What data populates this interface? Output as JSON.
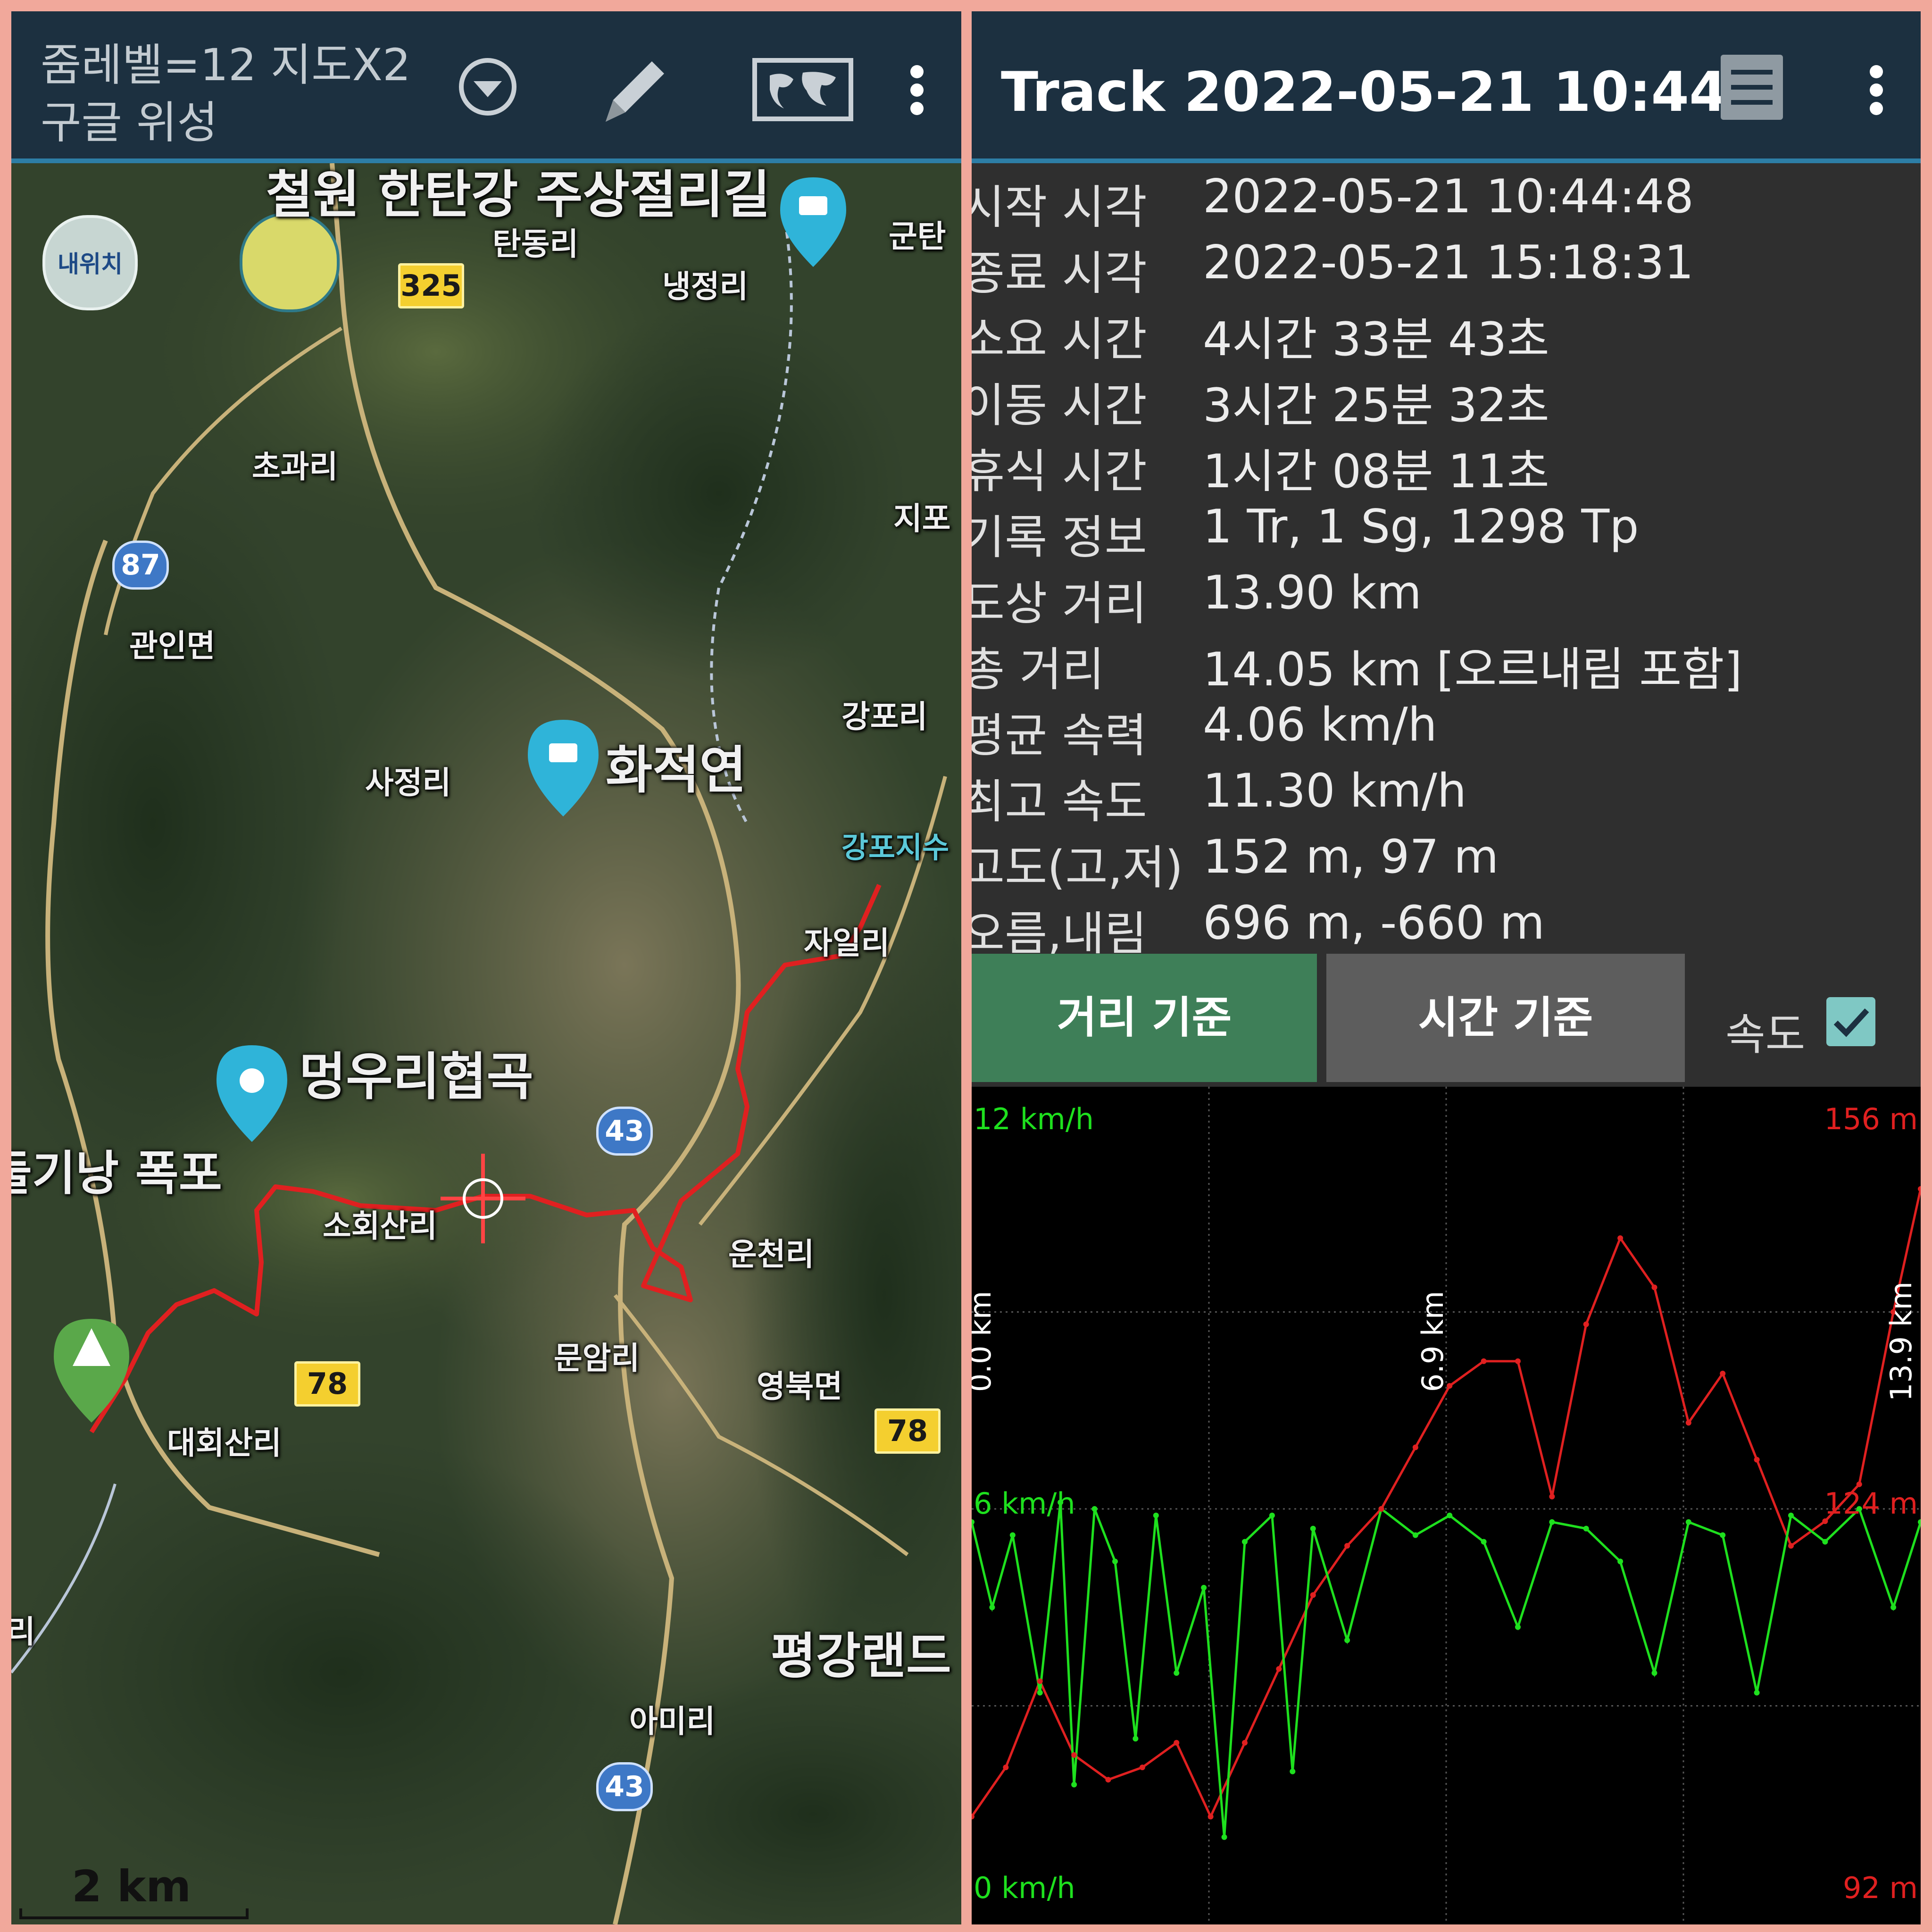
{
  "map_screen": {
    "zoom_line": "줌레벨=12 지도X2",
    "map_source": "구글 위성",
    "icons": [
      "dropdown-icon",
      "pencil-icon",
      "world-map-icon",
      "more-vert-icon"
    ],
    "my_location_button": "내위치",
    "place_labels": [
      {
        "id": "cheorwon",
        "text": "철원 한탄강 주상절리길"
      },
      {
        "id": "tandong",
        "text": "탄동리"
      },
      {
        "id": "nangjeong",
        "text": "냉정리"
      },
      {
        "id": "guntan",
        "text": "군탄"
      },
      {
        "id": "chogwa",
        "text": "초과리"
      },
      {
        "id": "jipo",
        "text": "지포"
      },
      {
        "id": "gwanin",
        "text": "관인면"
      },
      {
        "id": "gangpo",
        "text": "강포리"
      },
      {
        "id": "hwajeok",
        "text": "화적연"
      },
      {
        "id": "sajeong",
        "text": "사정리"
      },
      {
        "id": "gangpo_res",
        "text": "강포지수"
      },
      {
        "id": "jail",
        "text": "자일리"
      },
      {
        "id": "meongu",
        "text": "멍우리협곡"
      },
      {
        "id": "biduli",
        "text": "비둘기낭 폭포"
      },
      {
        "id": "sohoesan",
        "text": "소회산리"
      },
      {
        "id": "uncheon",
        "text": "운천리"
      },
      {
        "id": "munam",
        "text": "문암리"
      },
      {
        "id": "yeongbuk",
        "text": "영북면"
      },
      {
        "id": "daehoesan",
        "text": "대회산리"
      },
      {
        "id": "pyeonggang",
        "text": "평강랜드"
      },
      {
        "id": "ami",
        "text": "아미리"
      },
      {
        "id": "ri_left",
        "text": "리"
      }
    ],
    "route_shields": [
      "325",
      "78",
      "78"
    ],
    "national_shields": [
      "87",
      "43",
      "43"
    ],
    "scale_label": "2 km",
    "track_color": "#e02020"
  },
  "track_screen": {
    "title": "Track 2022-05-21 10:44",
    "icons": [
      "list-icon",
      "more-vert-icon"
    ],
    "stats": [
      {
        "label": "시작 시각",
        "value": "2022-05-21 10:44:48"
      },
      {
        "label": "종료 시각",
        "value": "2022-05-21 15:18:31"
      },
      {
        "label": "소요 시간",
        "value": "4시간 33분 43초"
      },
      {
        "label": "이동 시간",
        "value": "3시간 25분 32초"
      },
      {
        "label": "휴식 시간",
        "value": "1시간 08분 11초"
      },
      {
        "label": "기록 정보",
        "value": "1 Tr, 1 Sg, 1298 Tp"
      },
      {
        "label": "도상 거리",
        "value": "13.90 km"
      },
      {
        "label": "총 거리",
        "value": "14.05 km [오르내림 포함]"
      },
      {
        "label": "평균 속력",
        "value": "4.06 km/h"
      },
      {
        "label": "최고 속도",
        "value": "11.30 km/h"
      },
      {
        "label": "고도(고,저)",
        "value": "152 m, 97 m"
      },
      {
        "label": "오름,내림",
        "value": "696 m, -660 m"
      }
    ],
    "tabs": {
      "distance": "거리 기준",
      "time": "시간 기준"
    },
    "speed_toggle": {
      "label": "속도",
      "checked": true
    },
    "colors": {
      "speed": "#1ee01e",
      "altitude": "#e02020",
      "tab_active": "#3e7f58"
    }
  },
  "chart_data": {
    "type": "line",
    "x_axis": "distance",
    "x_markers": [
      "0.0 km",
      "6.9 km",
      "13.9 km"
    ],
    "x_marker_values": [
      0.0,
      6.9,
      13.9
    ],
    "xlim": [
      0.0,
      13.9
    ],
    "left_axis_labels": [
      "12 km/h",
      "6 km/h",
      "0 km/h"
    ],
    "right_axis_labels": [
      "156 m",
      "124 m",
      "92 m"
    ],
    "speed_ylim": [
      0,
      12
    ],
    "altitude_ylim": [
      92,
      156
    ],
    "grid": true,
    "series": [
      {
        "unit": "km/h",
        "x": [
          0.0,
          0.3,
          0.6,
          1.0,
          1.3,
          1.5,
          1.8,
          2.1,
          2.4,
          2.7,
          3.0,
          3.4,
          3.7,
          4.0,
          4.4,
          4.7,
          5.0,
          5.5,
          6.0,
          6.5,
          7.0,
          7.5,
          8.0,
          8.5,
          9.0,
          9.5,
          10.0,
          10.5,
          11.0,
          11.5,
          12.0,
          12.5,
          13.0,
          13.5,
          13.9
        ],
        "values": [
          5.8,
          4.5,
          5.6,
          3.2,
          6.1,
          1.8,
          6.0,
          5.2,
          2.5,
          5.9,
          3.5,
          4.8,
          1.0,
          5.5,
          5.9,
          2.0,
          5.7,
          4.0,
          6.0,
          5.6,
          5.9,
          5.5,
          4.2,
          5.8,
          5.7,
          5.2,
          3.5,
          5.8,
          5.6,
          3.2,
          5.9,
          5.5,
          6.0,
          4.5,
          5.8
        ]
      },
      {
        "unit": "m",
        "x": [
          0.0,
          0.5,
          1.0,
          1.5,
          2.0,
          2.5,
          3.0,
          3.5,
          4.0,
          4.5,
          5.0,
          5.5,
          6.0,
          6.5,
          7.0,
          7.5,
          8.0,
          8.5,
          9.0,
          9.5,
          10.0,
          10.5,
          11.0,
          11.5,
          12.0,
          12.5,
          13.0,
          13.5,
          13.9
        ],
        "values": [
          99,
          103,
          110,
          104,
          102,
          103,
          105,
          99,
          105,
          111,
          117,
          121,
          124,
          129,
          134,
          136,
          136,
          125,
          139,
          146,
          142,
          131,
          135,
          128,
          121,
          123,
          126,
          140,
          150
        ]
      }
    ]
  }
}
